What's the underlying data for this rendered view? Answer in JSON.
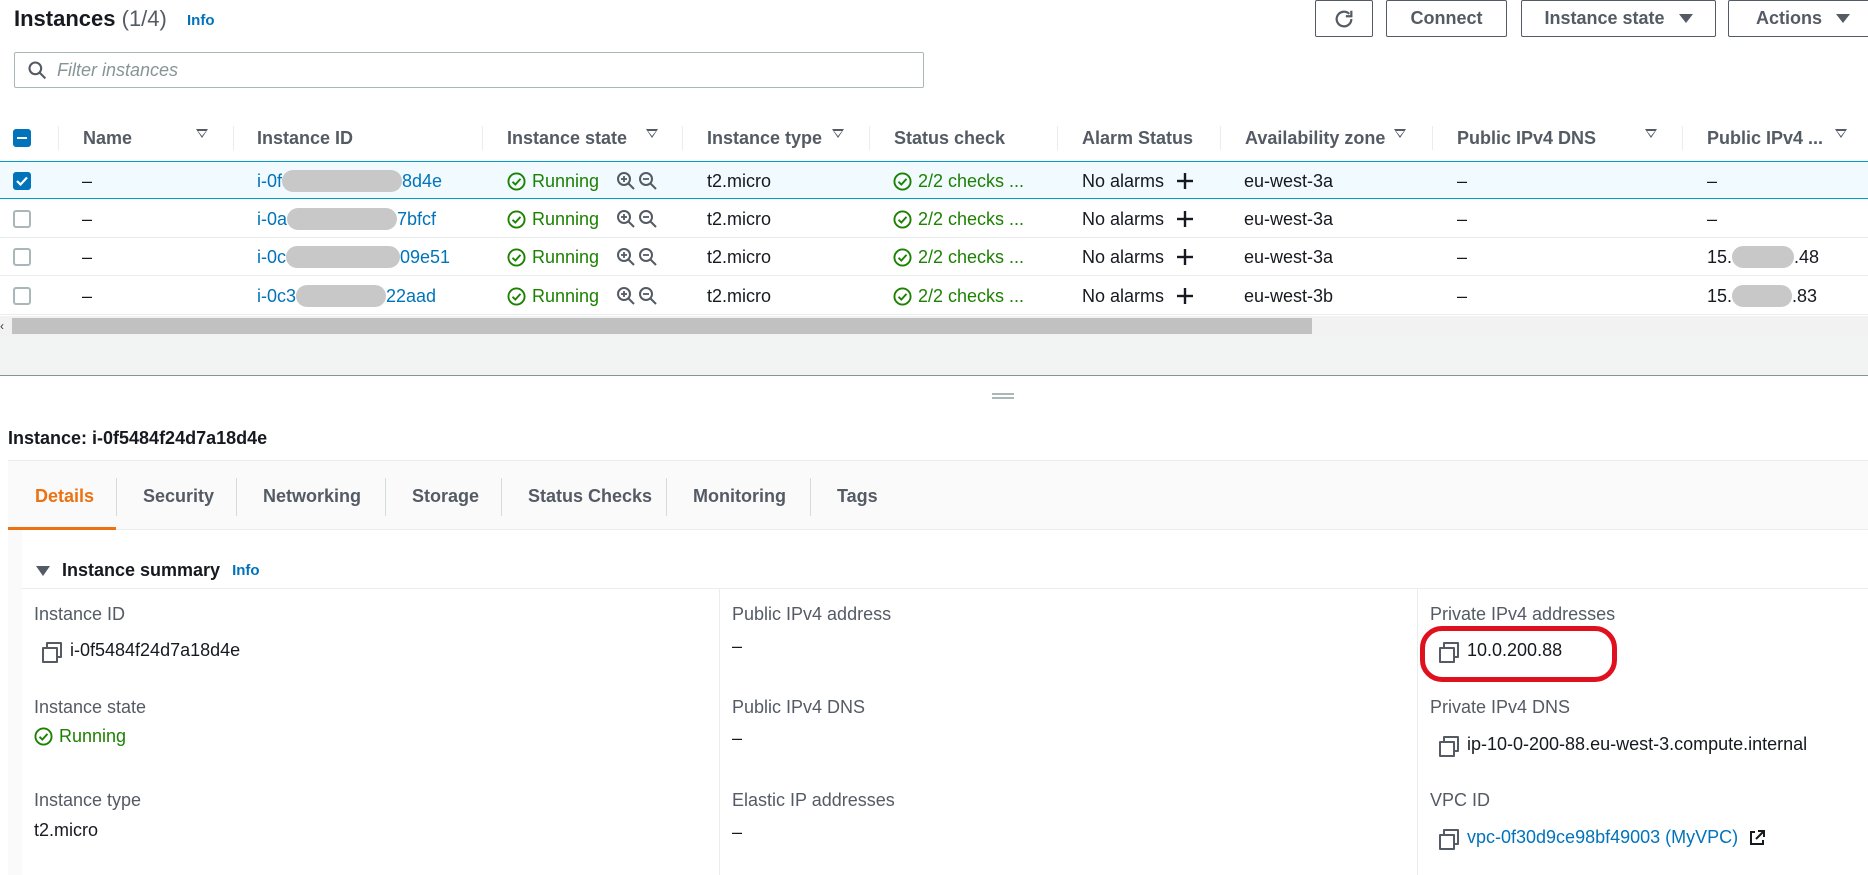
{
  "header": {
    "title": "Instances",
    "count": "(1/4)",
    "info": "Info",
    "connect_label": "Connect",
    "instance_state_label": "Instance state",
    "actions_label": "Actions"
  },
  "filter": {
    "placeholder": "Filter instances"
  },
  "table": {
    "columns": [
      "Name",
      "Instance ID",
      "Instance state",
      "Instance type",
      "Status check",
      "Alarm Status",
      "Availability zone",
      "Public IPv4 DNS",
      "Public IPv4 ..."
    ],
    "rows": [
      {
        "name": "–",
        "id_prefix": "i-0f",
        "id_suffix": "8d4e",
        "state": "Running",
        "type": "t2.micro",
        "status": "2/2 checks ...",
        "alarm": "No alarms",
        "az": "eu-west-3a",
        "dns": "–",
        "ipv4_prefix": "–",
        "ipv4_suffix": ""
      },
      {
        "name": "–",
        "id_prefix": "i-0a",
        "id_suffix": "7bfcf",
        "state": "Running",
        "type": "t2.micro",
        "status": "2/2 checks ...",
        "alarm": "No alarms",
        "az": "eu-west-3a",
        "dns": "–",
        "ipv4_prefix": "–",
        "ipv4_suffix": ""
      },
      {
        "name": "–",
        "id_prefix": "i-0c",
        "id_suffix": "09e51",
        "state": "Running",
        "type": "t2.micro",
        "status": "2/2 checks ...",
        "alarm": "No alarms",
        "az": "eu-west-3a",
        "dns": "–",
        "ipv4_prefix": "15.",
        "ipv4_suffix": ".48"
      },
      {
        "name": "–",
        "id_prefix": "i-0c3",
        "id_suffix": "22aad",
        "state": "Running",
        "type": "t2.micro",
        "status": "2/2 checks ...",
        "alarm": "No alarms",
        "az": "eu-west-3b",
        "dns": "–",
        "ipv4_prefix": "15.",
        "ipv4_suffix": ".83"
      }
    ]
  },
  "details": {
    "instance_title": "Instance: i-0f5484f24d7a18d4e",
    "tabs": [
      "Details",
      "Security",
      "Networking",
      "Storage",
      "Status Checks",
      "Monitoring",
      "Tags"
    ],
    "summary_title": "Instance summary",
    "summary_info": "Info",
    "instance_id_label": "Instance ID",
    "instance_id_value": "i-0f5484f24d7a18d4e",
    "instance_state_label": "Instance state",
    "instance_state_value": "Running",
    "instance_type_label": "Instance type",
    "instance_type_value": "t2.micro",
    "public_ipv4_label": "Public IPv4 address",
    "public_ipv4_value": "–",
    "public_dns_label": "Public IPv4 DNS",
    "public_dns_value": "–",
    "elastic_ip_label": "Elastic IP addresses",
    "elastic_ip_value": "–",
    "private_ipv4_label": "Private IPv4 addresses",
    "private_ipv4_value": "10.0.200.88",
    "private_dns_label": "Private IPv4 DNS",
    "private_dns_value": "ip-10-0-200-88.eu-west-3.compute.internal",
    "vpc_label": "VPC ID",
    "vpc_value": "vpc-0f30d9ce98bf49003 (MyVPC)"
  },
  "colors": {
    "link": "#0073bb",
    "running_green": "#1d8102",
    "active_tab": "#ec7211",
    "highlight_red": "#e0111f"
  }
}
